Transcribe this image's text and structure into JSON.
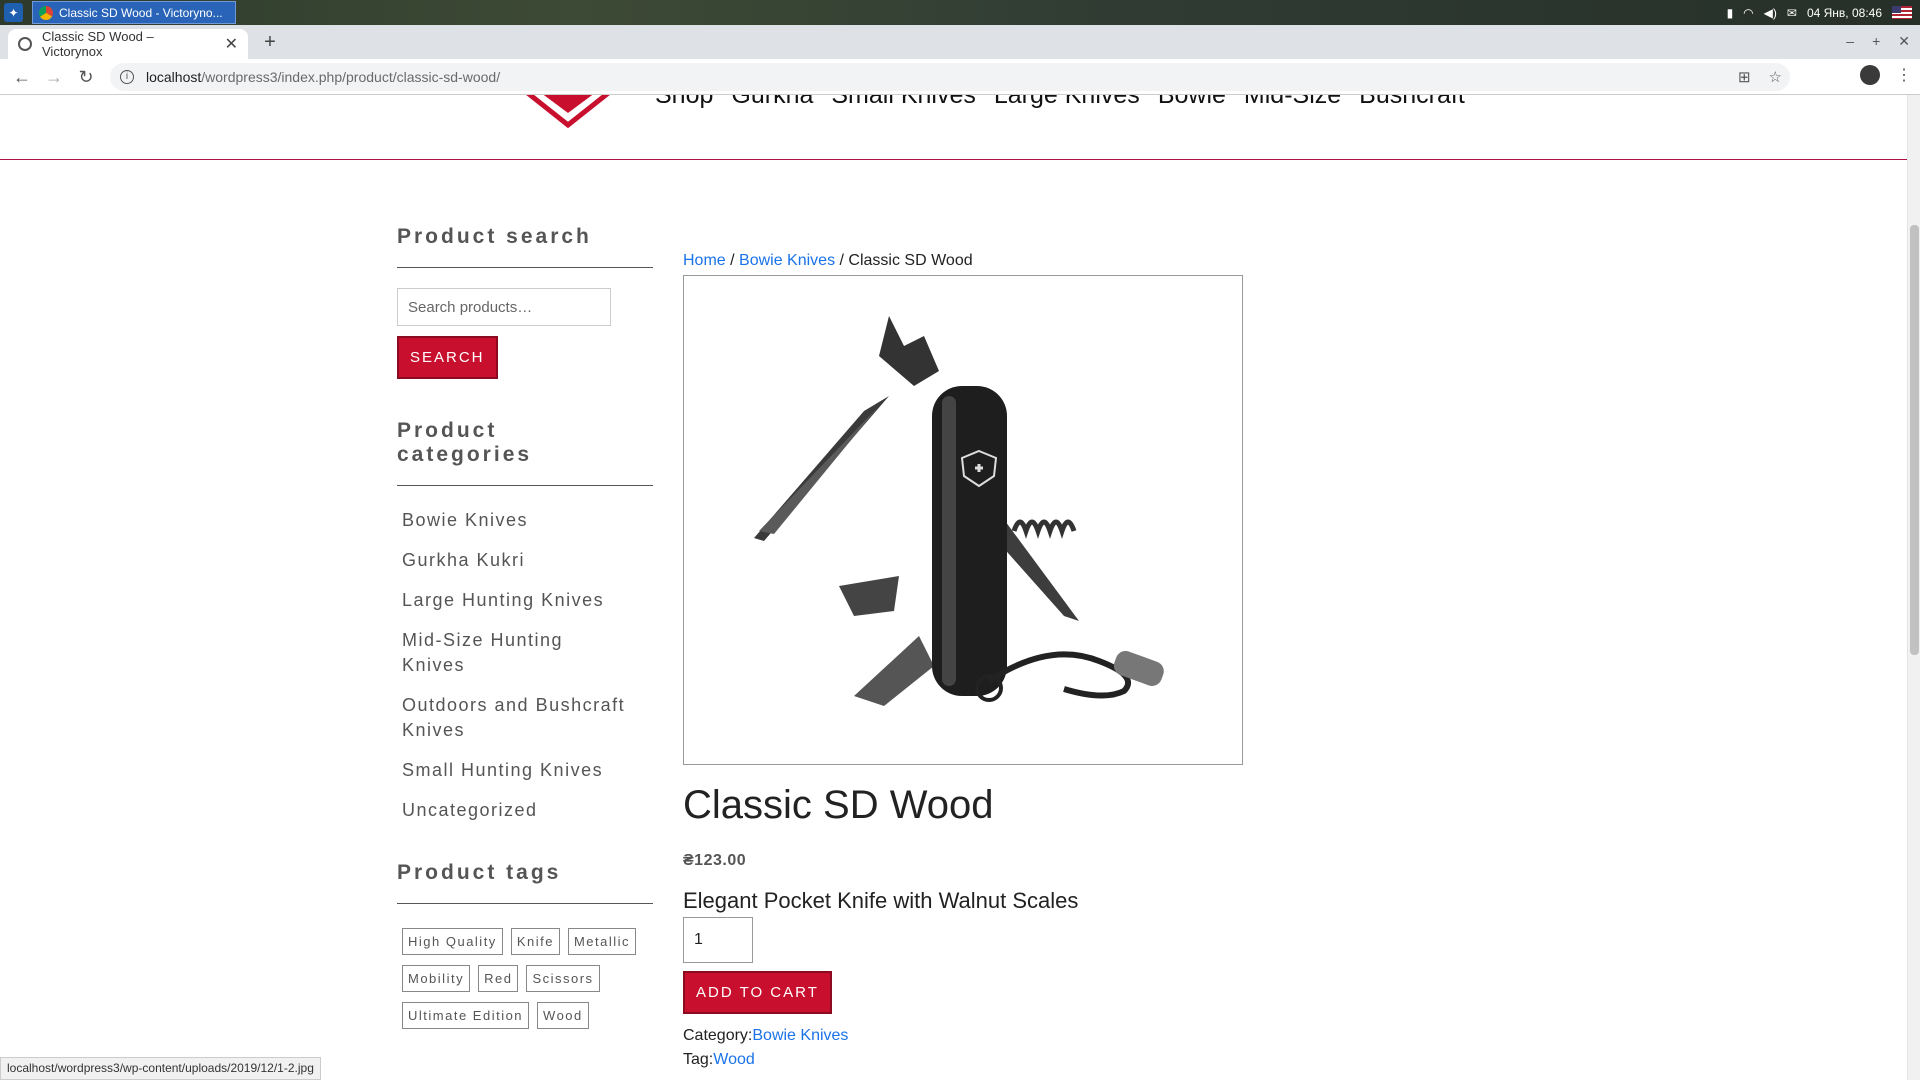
{
  "taskbar": {
    "window_title": "Classic SD Wood - Victoryno...",
    "clock": "04 Янв, 08:46"
  },
  "browser": {
    "tab_title": "Classic SD Wood – Victorynox",
    "url_host": "localhost",
    "url_path": "/wordpress3/index.php/product/classic-sd-wood/",
    "status_url": "localhost/wordpress3/wp-content/uploads/2019/12/1-2.jpg"
  },
  "header": {
    "nav": [
      "Shop",
      "Gurkha",
      "Small Knives",
      "Large Knives",
      "Bowie",
      "Mid-Size",
      "Bushcraft"
    ]
  },
  "sidebar": {
    "search_title": "Product search",
    "search_placeholder": "Search products…",
    "search_button": "SEARCH",
    "categories_title": "Product categories",
    "categories": [
      "Bowie Knives",
      "Gurkha Kukri",
      "Large Hunting Knives",
      "Mid-Size Hunting Knives",
      "Outdoors and Bushcraft Knives",
      "Small Hunting Knives",
      "Uncategorized"
    ],
    "tags_title": "Product tags",
    "tags": [
      "High Quality",
      "Knife",
      "Metallic",
      "Mobility",
      "Red",
      "Scissors",
      "Ultimate Edition",
      "Wood"
    ]
  },
  "product": {
    "breadcrumb": {
      "home": "Home",
      "sep": " / ",
      "category": "Bowie Knives",
      "current": "Classic SD Wood"
    },
    "title": "Classic SD Wood",
    "price": "₴123.00",
    "short_description": "Elegant Pocket Knife with Walnut Scales",
    "quantity": "1",
    "add_to_cart": "ADD TO CART",
    "category_label": "Category:",
    "category": "Bowie Knives",
    "tag_label": "Tag:",
    "tag": "Wood"
  },
  "colors": {
    "accent": "#c8102e",
    "link": "#1a73e8"
  }
}
